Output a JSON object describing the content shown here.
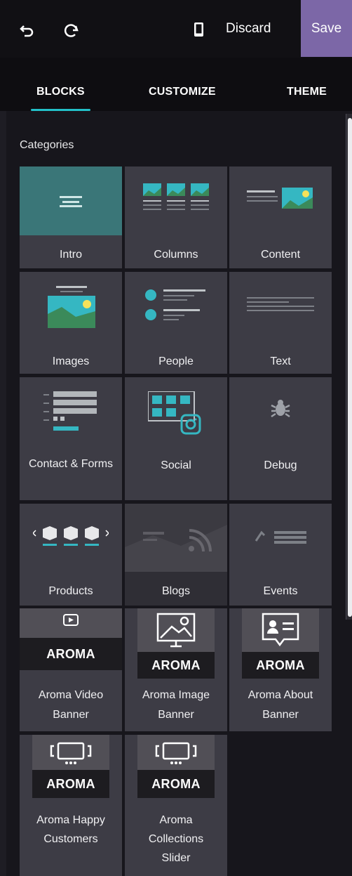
{
  "toolbar": {
    "discard_label": "Discard",
    "save_label": "Save"
  },
  "tabs": [
    "BLOCKS",
    "CUSTOMIZE",
    "THEME"
  ],
  "categories_title": "Categories",
  "tiles": [
    "Intro",
    "Columns",
    "Content",
    "Images",
    "People",
    "Text",
    "Contact & Forms",
    "Social",
    "Debug",
    "Products",
    "Blogs",
    "Events"
  ],
  "snippets": [
    {
      "label": "Aroma Video Banner",
      "badge": "AROMA"
    },
    {
      "label": "Aroma Image Banner",
      "badge": "AROMA"
    },
    {
      "label": "Aroma About Banner",
      "badge": "AROMA"
    },
    {
      "label": "Aroma Happy Customers",
      "badge": "AROMA"
    },
    {
      "label": "Aroma Collections Slider",
      "badge": "AROMA"
    }
  ],
  "colors": {
    "accent": "#23c0c8",
    "save": "#7c67a7",
    "intro_bg": "#3a7678",
    "tile": "#3d3c45"
  },
  "icons": [
    "undo-icon",
    "redo-icon",
    "mobile-icon"
  ]
}
